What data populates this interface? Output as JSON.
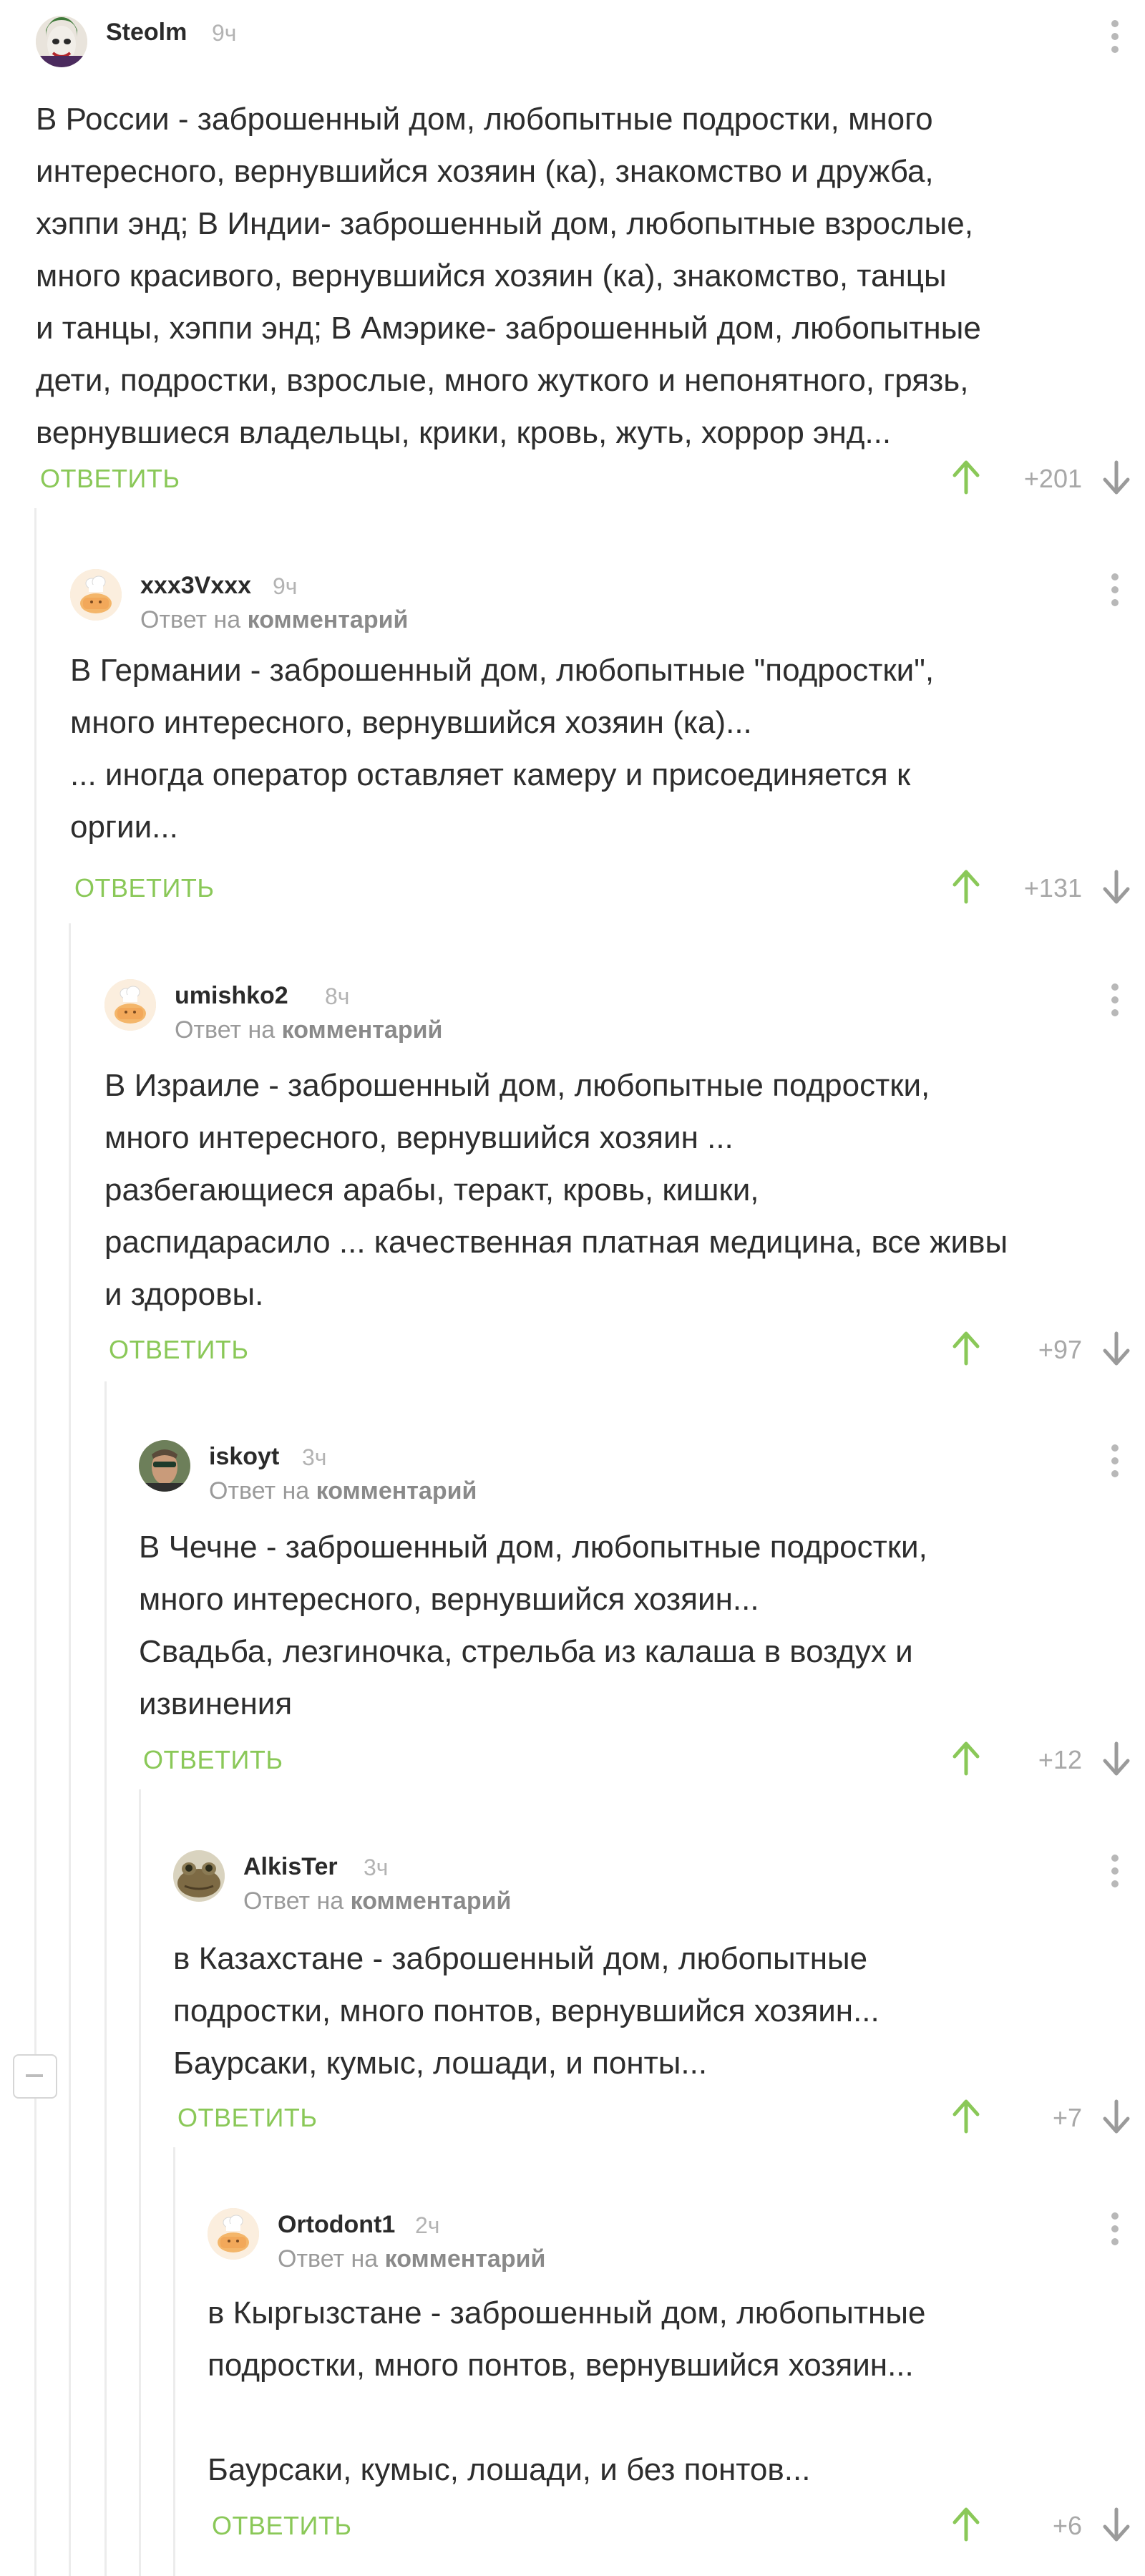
{
  "ui": {
    "reply_label": "ОТВЕТИТЬ",
    "reply_to_prefix": "Ответ на",
    "reply_to_target": "комментарий",
    "accent_color": "#8ac858"
  },
  "comments": [
    {
      "username": "Steolm",
      "time": "9ч",
      "reply_to": false,
      "avatar": "joker-avatar",
      "text_lines": [
        "В России - заброшенный дом, любопытные подростки, много",
        "интересного, вернувшийся хозяин (ка), знакомство и дружба,",
        "хэппи энд; В Индии- заброшенный дом, любопытные взрослые,",
        "много красивого, вернувшийся хозяин (ка), знакомство, танцы",
        "и танцы, хэппи энд; В Амэрике- заброшенный дом, любопытные",
        "дети, подростки, взрослые, много жуткого и непонятного, грязь,",
        "вернувшиеся владельцы, крики, кровь, жуть, хоррор энд..."
      ],
      "rating": "+201"
    },
    {
      "username": "xxx3Vxxx",
      "time": "9ч",
      "reply_to": true,
      "avatar": "default-chef-avatar",
      "text_lines": [
        "В Германии - заброшенный дом, любопытные \"подростки\",",
        "много интересного, вернувшийся хозяин (ка)...",
        "... иногда оператор оставляет камеру и присоединяется к",
        "оргии..."
      ],
      "rating": "+131"
    },
    {
      "username": "umishko2",
      "time": "8ч",
      "reply_to": true,
      "avatar": "default-chef-avatar",
      "text_lines": [
        "В Израиле - заброшенный дом, любопытные подростки,",
        "много интересного, вернувшийся хозяин ...",
        "разбегающиеся арабы, теракт, кровь, кишки,",
        "распидарасило ... качественная платная медицина, все живы",
        "и здоровы."
      ],
      "rating": "+97"
    },
    {
      "username": "iskoyt",
      "time": "3ч",
      "reply_to": true,
      "avatar": "photo-avatar",
      "text_lines": [
        "В Чечне - заброшенный дом, любопытные подростки,",
        "много интересного, вернувшийся хозяин...",
        "Свадьба, лезгиночка, стрельба из калаша в воздух и",
        "извинения"
      ],
      "rating": "+12"
    },
    {
      "username": "AlkisTer",
      "time": "3ч",
      "reply_to": true,
      "avatar": "frog-avatar",
      "text_lines": [
        "в Казахстане - заброшенный дом, любопытные",
        "подростки, много понтов, вернувшийся хозяин...",
        "Баурсаки, кумыс, лошади, и понты..."
      ],
      "rating": "+7"
    },
    {
      "username": "Ortodont1",
      "time": "2ч",
      "reply_to": true,
      "avatar": "default-chef-avatar",
      "text_lines": [
        "в Кыргызстане - заброшенный дом, любопытные",
        "подростки, много понтов, вернувшийся хозяин...",
        "",
        "Баурсаки, кумыс, лошади, и без понтов..."
      ],
      "rating": "+6"
    }
  ]
}
